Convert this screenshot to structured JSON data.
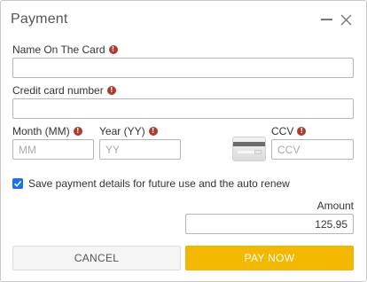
{
  "dialog": {
    "title": "Payment"
  },
  "form": {
    "name_label": "Name On The Card",
    "name_value": "",
    "card_number_label": "Credit card number",
    "card_number_value": "",
    "month_label": "Month (MM)",
    "month_placeholder": "MM",
    "year_label": "Year (YY)",
    "year_placeholder": "YY",
    "ccv_label": "CCV",
    "ccv_placeholder": "CCV",
    "required_mark": "!",
    "save_details_label": "Save payment details for future use and the auto renew",
    "save_details_checked": true,
    "amount_label": "Amount",
    "amount_value": "125.95"
  },
  "buttons": {
    "cancel": "CANCEL",
    "pay": "PAY NOW"
  },
  "colors": {
    "accent": "#f5b800",
    "checkbox": "#1a73e8",
    "required": "#b03a2e"
  },
  "icons": [
    "minimize-icon",
    "close-icon",
    "required-icon",
    "credit-card-icon",
    "checkmark-icon"
  ]
}
